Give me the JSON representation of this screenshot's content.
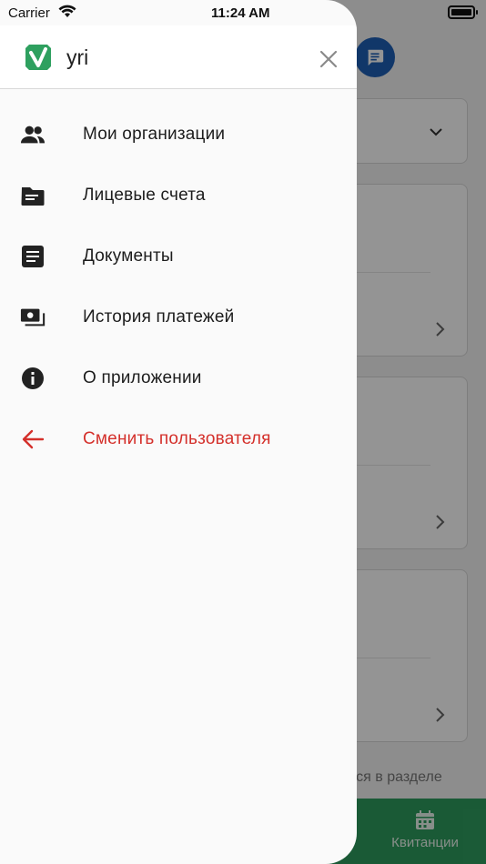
{
  "status_bar": {
    "carrier": "Carrier",
    "time": "11:24 AM"
  },
  "drawer": {
    "app_name": "yri",
    "brand_color": "#2ea05f",
    "menu": [
      {
        "label": "Мои организации",
        "icon": "people-icon"
      },
      {
        "label": "Лицевые счета",
        "icon": "folder-icon"
      },
      {
        "label": "Документы",
        "icon": "document-icon"
      },
      {
        "label": "История платежей",
        "icon": "payments-icon"
      },
      {
        "label": "О приложении",
        "icon": "info-icon"
      },
      {
        "label": "Сменить пользователя",
        "icon": "arrow-back-icon",
        "color": "#d4302b"
      }
    ]
  },
  "background": {
    "footer_text": "тся в разделе",
    "tab_label": "Квитанции",
    "accent": "#2e9c5e"
  }
}
